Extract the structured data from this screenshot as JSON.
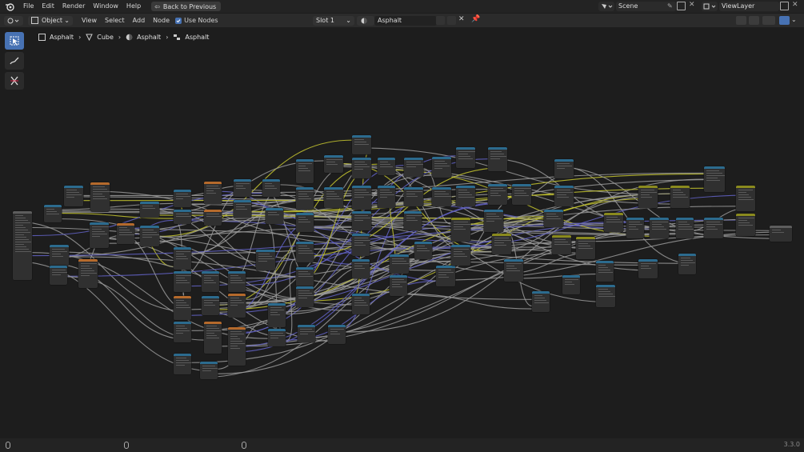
{
  "menus": [
    "File",
    "Edit",
    "Render",
    "Window",
    "Help"
  ],
  "back_button": "Back to Previous",
  "scene": {
    "name": "Scene",
    "view_layer": "ViewLayer"
  },
  "header": {
    "mode": "Object",
    "menus": [
      "View",
      "Select",
      "Add",
      "Node"
    ],
    "use_nodes": "Use Nodes",
    "slot": "Slot 1",
    "material": "Asphalt"
  },
  "breadcrumb": [
    {
      "label": "Asphalt",
      "icon": "object-icon"
    },
    {
      "label": "Cube",
      "icon": "mesh-icon"
    },
    {
      "label": "Asphalt",
      "icon": "material-icon"
    },
    {
      "label": "Asphalt",
      "icon": "node-tree-icon"
    }
  ],
  "version": "3.3.0",
  "colors": {
    "accent": "#4772b3",
    "header_blue": "#2c6b8e",
    "header_orange": "#b56a2c",
    "header_olive": "#8a8a1e",
    "wire_gray": "#9a9a9a",
    "wire_yellow": "#c7c72f",
    "wire_purple": "#6363c7"
  }
}
